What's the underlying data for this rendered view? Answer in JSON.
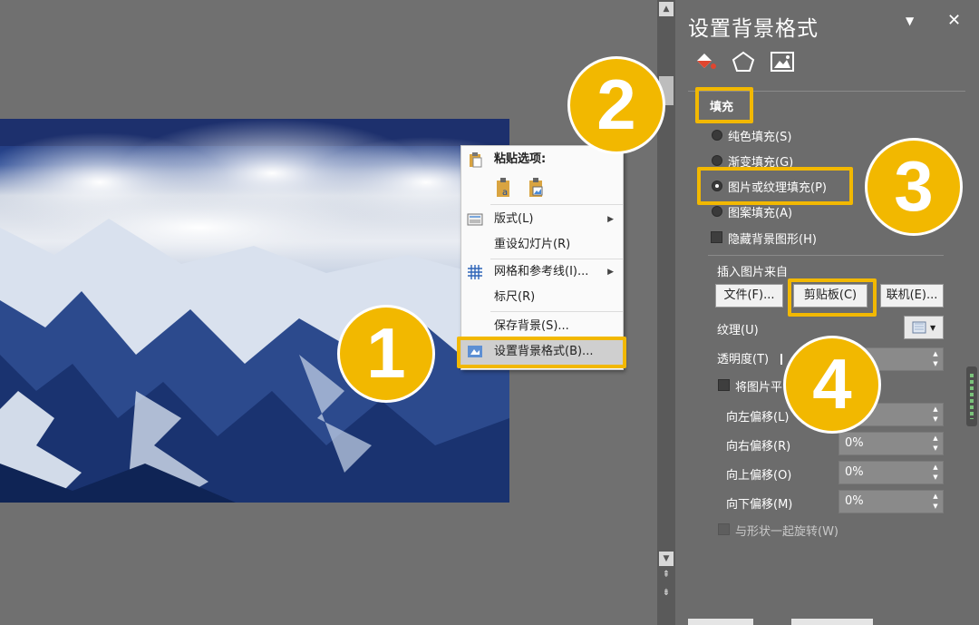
{
  "context_menu": {
    "paste_header": "粘贴选项:",
    "items": {
      "layout": "版式(L)",
      "reset_slide": "重设幻灯片(R)",
      "grid_guides": "网格和参考线(I)...",
      "ruler": "标尺(R)",
      "save_background": "保存背景(S)...",
      "format_background": "设置背景格式(B)..."
    }
  },
  "pane": {
    "title": "设置背景格式",
    "section_fill": "填充",
    "options": {
      "solid": "纯色填充(S)",
      "gradient": "渐变填充(G)",
      "picture_texture": "图片或纹理填充(P)",
      "pattern": "图案填充(A)",
      "hide_background": "隐藏背景图形(H)"
    },
    "insert_from": "插入图片来自",
    "buttons": {
      "file": "文件(F)...",
      "clipboard": "剪贴板(C)",
      "online": "联机(E)..."
    },
    "texture_label": "纹理(U)",
    "transparency_label": "透明度(T)",
    "tile_label": "将图片平",
    "offsets": [
      {
        "label": "向左偏移(L)",
        "value": ""
      },
      {
        "label": "向右偏移(R)",
        "value": "0%"
      },
      {
        "label": "向上偏移(O)",
        "value": "0%"
      },
      {
        "label": "向下偏移(M)",
        "value": "0%"
      }
    ],
    "rotate_with_shape": "与形状一起旋转(W)"
  },
  "badges": [
    "1",
    "2",
    "3",
    "4"
  ],
  "colors": {
    "highlight": "#f2b800",
    "pane_bg": "#6c6c6c",
    "slide_sky": "#1c2f6e"
  }
}
